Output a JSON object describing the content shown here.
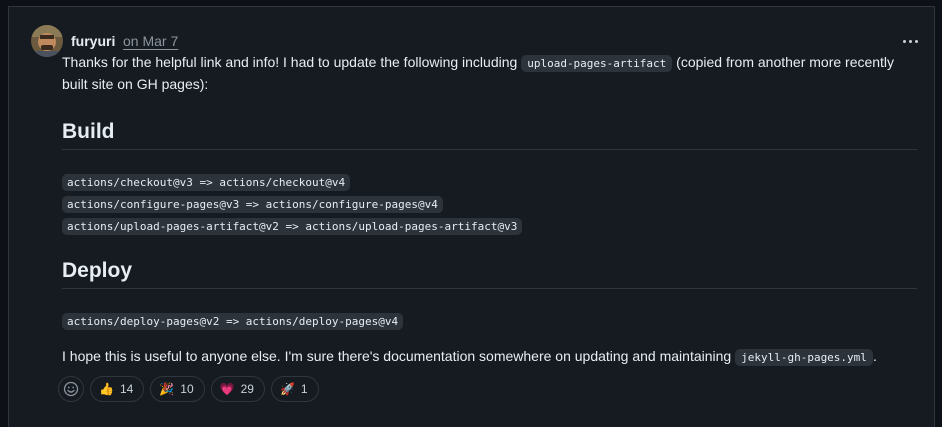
{
  "comment": {
    "author": "furyuri",
    "date": "on Mar 7",
    "paragraph1": {
      "before": "Thanks for the helpful link and info! I had to update the following including ",
      "code": "upload-pages-artifact",
      "after_line1": " (copied from another more recently",
      "line2": "built site on GH pages):"
    },
    "build_heading": "Build",
    "build_lines": [
      "actions/checkout@v3 => actions/checkout@v4",
      "actions/configure-pages@v3 => actions/configure-pages@v4",
      "actions/upload-pages-artifact@v2 => actions/upload-pages-artifact@v3"
    ],
    "deploy_heading": "Deploy",
    "deploy_lines": [
      "actions/deploy-pages@v2 => actions/deploy-pages@v4"
    ],
    "paragraph2": {
      "before": "I hope this is useful to anyone else. I'm sure there's documentation somewhere on updating and maintaining ",
      "code": "jekyll-gh-pages.yml",
      "after": "."
    }
  },
  "reactions": [
    {
      "icon": "thumbs-up-icon",
      "emoji": "👍",
      "count": "14"
    },
    {
      "icon": "hooray-icon",
      "emoji": "🎉",
      "count": "10"
    },
    {
      "icon": "heart-icon",
      "emoji": "💗",
      "count": "29"
    },
    {
      "icon": "rocket-icon",
      "emoji": "🚀",
      "count": "1"
    }
  ],
  "colors": {
    "background": "#0d1117",
    "card": "#161b22",
    "border": "#30363d",
    "text": "#e6edf3",
    "muted": "#8b949e",
    "code_bg": "#2d333b"
  }
}
